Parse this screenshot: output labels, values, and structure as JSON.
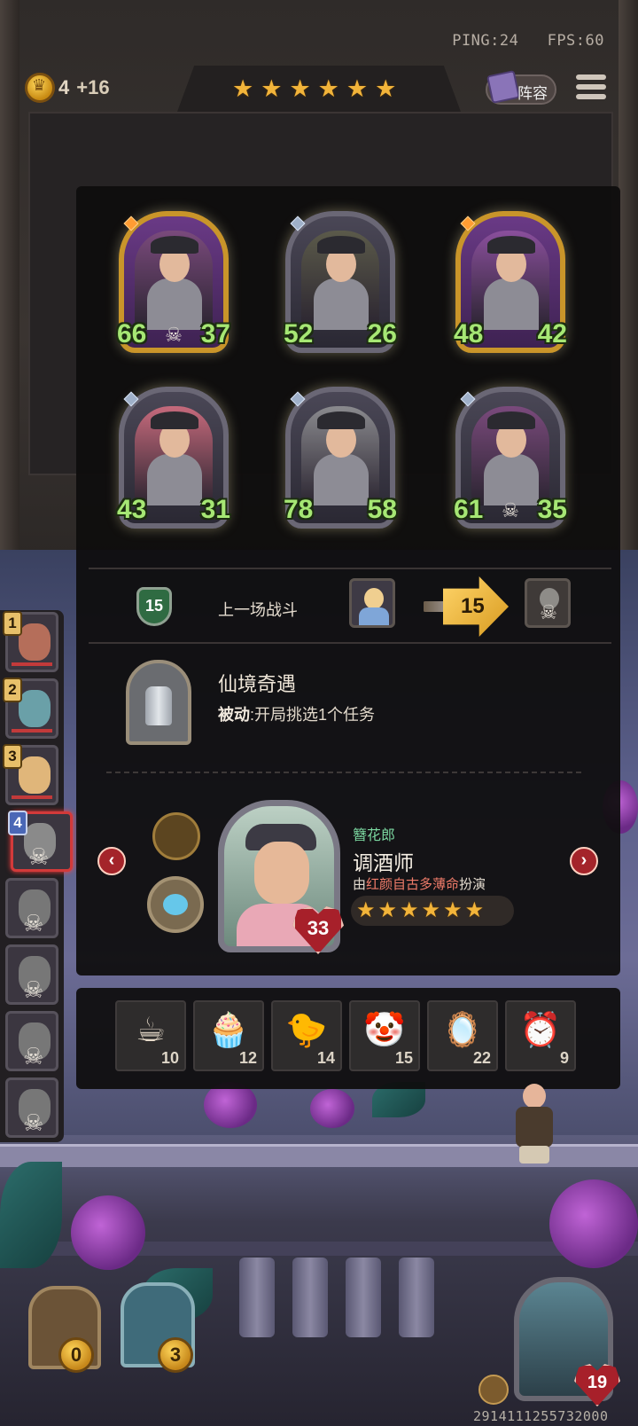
{
  "hud": {
    "ping": "PING:24",
    "fps": "FPS:60",
    "coins": "4",
    "coins_income": "+16",
    "tavern_stars": 6,
    "lineup_label": "阵容"
  },
  "hero_cards": [
    {
      "attack": "66",
      "health": "37",
      "frame": "gold",
      "dead": true,
      "art_color": "#7a4a7c"
    },
    {
      "attack": "52",
      "health": "26",
      "frame": "silver",
      "dead": false,
      "art_color": "#5b5a4a"
    },
    {
      "attack": "48",
      "health": "42",
      "frame": "gold",
      "dead": false,
      "art_color": "#8a4f9c"
    },
    {
      "attack": "43",
      "health": "31",
      "frame": "silver",
      "dead": false,
      "art_color": "#c66a7c"
    },
    {
      "attack": "78",
      "health": "58",
      "frame": "silver",
      "dead": false,
      "art_color": "#8a8a8e"
    },
    {
      "attack": "61",
      "health": "35",
      "frame": "silver",
      "dead": true,
      "art_color": "#7a4a7c"
    }
  ],
  "last_battle": {
    "tier": "15",
    "label": "上一场战斗",
    "damage": "15"
  },
  "trinket": {
    "title": "仙境奇遇",
    "desc_bold": "被动",
    "desc_rest": ":开局挑选1个任务"
  },
  "hero": {
    "subtitle": "簪花郎",
    "name": "调酒师",
    "credit_prefix": "由",
    "credit_player": "红颜自古多薄命",
    "credit_suffix": "扮演",
    "health": "33",
    "stars": 6,
    "prev_label": "‹",
    "next_label": "›"
  },
  "items": [
    {
      "icon": "teacup-icon",
      "glyph": "☕",
      "count": "10"
    },
    {
      "icon": "cupcake-icon",
      "glyph": "🧁",
      "count": "12"
    },
    {
      "icon": "chick-icon",
      "glyph": "🐤",
      "count": "14"
    },
    {
      "icon": "clown-icon",
      "glyph": "🤡",
      "count": "15"
    },
    {
      "icon": "mirror-icon",
      "glyph": "🪞",
      "count": "22"
    },
    {
      "icon": "alarm-clock-icon",
      "glyph": "⏰",
      "count": "9"
    }
  ],
  "opponents": [
    {
      "rank": "1",
      "dead": false,
      "selected": false,
      "color": "#b56e5a"
    },
    {
      "rank": "2",
      "dead": false,
      "selected": false,
      "color": "#6aa0a8"
    },
    {
      "rank": "3",
      "dead": false,
      "selected": false,
      "color": "#e0b67a"
    },
    {
      "rank": "4",
      "dead": true,
      "selected": true,
      "color": "#8a8a8a"
    },
    {
      "rank": "",
      "dead": true,
      "selected": false,
      "color": "#777"
    },
    {
      "rank": "",
      "dead": true,
      "selected": false,
      "color": "#777"
    },
    {
      "rank": "",
      "dead": true,
      "selected": false,
      "color": "#777"
    },
    {
      "rank": "",
      "dead": true,
      "selected": false,
      "color": "#777"
    }
  ],
  "bottom": {
    "chest_coins": "0",
    "chest2_coins": "3",
    "boss_health": "19",
    "footer_id": "2914111255732000"
  },
  "colors": {
    "stat_green": "#a6e774",
    "star_gold": "#f2b43a",
    "selected_red": "#d33a3a"
  }
}
